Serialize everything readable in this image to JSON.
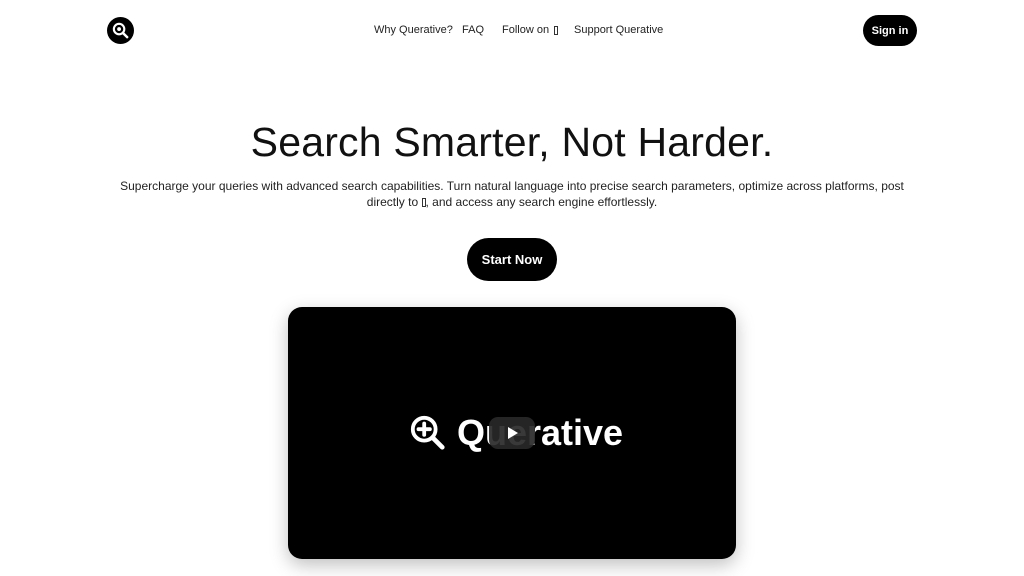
{
  "header": {
    "logo_icon": "search-zoom-icon",
    "nav": [
      {
        "label": "Why Querative?"
      },
      {
        "label": "FAQ"
      },
      {
        "label": "Follow on",
        "icon": "x-logo-icon"
      },
      {
        "label": "Support Querative"
      }
    ],
    "signin_label": "Sign in"
  },
  "hero": {
    "title": "Search Smarter, Not Harder.",
    "subtitle_part1": "Supercharge your queries with advanced search capabilities. Turn natural language into precise search parameters, optimize across platforms, post directly to",
    "subtitle_part2": ", and access any search engine effortlessly.",
    "cta_label": "Start Now"
  },
  "video": {
    "brand_text": "Querative",
    "brand_icon": "zoom-in-icon",
    "play_icon": "play-icon"
  },
  "colors": {
    "primary": "#000000",
    "background": "#ffffff",
    "text": "#111111"
  }
}
